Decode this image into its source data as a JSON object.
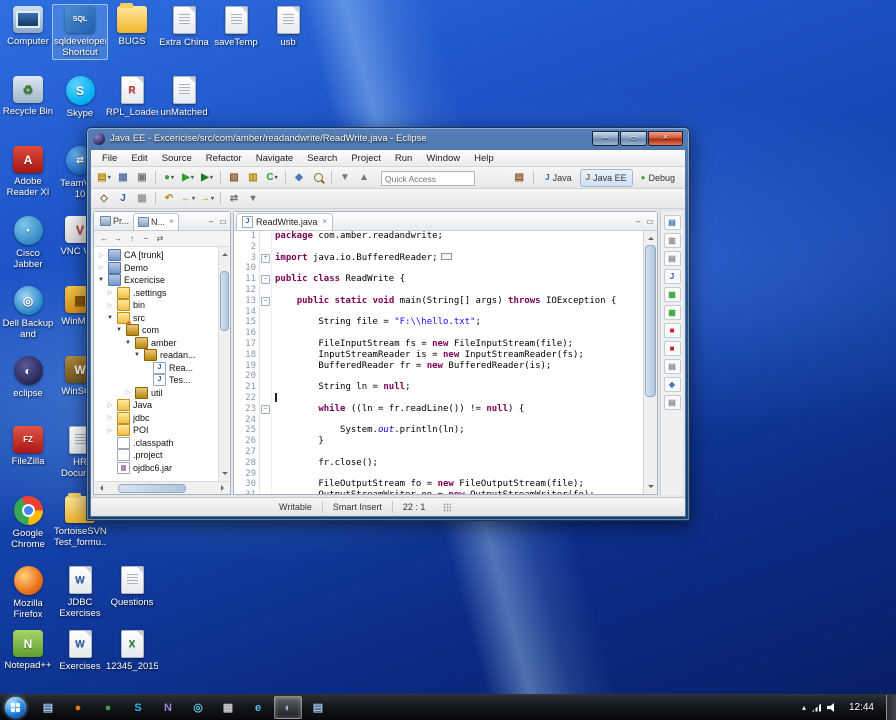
{
  "desktop": {
    "icons": [
      {
        "label": "Computer",
        "row": 0,
        "col": 0,
        "type": "pc"
      },
      {
        "label": "sqldeveloper Shortcut",
        "row": 0,
        "col": 1,
        "type": "app",
        "bg": "linear-gradient(135deg,#4e8fd0,#1f5fae)",
        "glyph": "SQL",
        "gs": 7,
        "selected": true
      },
      {
        "label": "BUGS",
        "row": 0,
        "col": 2,
        "type": "folder"
      },
      {
        "label": "Extra China",
        "row": 0,
        "col": 3,
        "type": "doc"
      },
      {
        "label": "saveTemp",
        "row": 0,
        "col": 4,
        "type": "doc"
      },
      {
        "label": "usb",
        "row": 0,
        "col": 5,
        "type": "doc"
      },
      {
        "label": "Recycle Bin",
        "row": 1,
        "col": 0,
        "type": "app",
        "bg": "linear-gradient(#dfe9f2,#9fb6c9)",
        "glyph": "♻",
        "fg": "#3f7a36"
      },
      {
        "label": "Skype",
        "row": 1,
        "col": 1,
        "type": "app",
        "bg": "radial-gradient(circle at 35% 30%,#5fd0ff,#00aff0 70%)",
        "glyph": "S",
        "round": true
      },
      {
        "label": "RPL_Loader",
        "row": 1,
        "col": 2,
        "type": "doc",
        "dl": "R",
        "dc": "#c0392b"
      },
      {
        "label": "unMatched",
        "row": 1,
        "col": 3,
        "type": "doc"
      },
      {
        "label": "Adobe Reader XI",
        "row": 2,
        "col": 0,
        "type": "app",
        "bg": "linear-gradient(#e24b3a,#a31515)",
        "glyph": "A"
      },
      {
        "label": "TeamVi... 10",
        "row": 2,
        "col": 1,
        "type": "app",
        "bg": "radial-gradient(circle at 35% 30%,#6db3f2,#1565c0 75%)",
        "glyph": "⇄",
        "gs": 9,
        "round": true
      },
      {
        "label": "Cisco Jabber",
        "row": 3,
        "col": 0,
        "type": "app",
        "bg": "radial-gradient(circle at 35% 30%,#7cc6ec,#2e86c1 75%)",
        "glyph": "●",
        "fg": "#ffffff",
        "gs": 6,
        "round": true
      },
      {
        "label": "VNC Vi...",
        "row": 3,
        "col": 1,
        "type": "app",
        "bg": "linear-gradient(#f6f6f6,#d8d8d8)",
        "glyph": "V",
        "fg": "#c0392b"
      },
      {
        "label": "Dell Backup and Recovery",
        "row": 4,
        "col": 0,
        "type": "app",
        "bg": "radial-gradient(circle at 40% 35%,#9fd4f5,#1b7ec2 75%)",
        "glyph": "◎",
        "round": true
      },
      {
        "label": "WinMe...",
        "row": 4,
        "col": 1,
        "type": "app",
        "bg": "linear-gradient(#f6c94a,#d98e1a)",
        "glyph": "▤",
        "fg": "#7a4a00"
      },
      {
        "label": "eclipse",
        "row": 5,
        "col": 0,
        "type": "app",
        "bg": "radial-gradient(circle at 40% 35%,#5a5a9e,#24244e 75%)",
        "glyph": "◐",
        "round": true
      },
      {
        "label": "WinSC...",
        "row": 5,
        "col": 1,
        "type": "app",
        "bg": "linear-gradient(#b08a3e,#6e5420)",
        "glyph": "W"
      },
      {
        "label": "FileZilla",
        "row": 6,
        "col": 0,
        "type": "app",
        "bg": "linear-gradient(#e05545,#b01515)",
        "glyph": "FZ",
        "gs": 8
      },
      {
        "label": "HR Docum...",
        "row": 6,
        "col": 1,
        "type": "doc"
      },
      {
        "label": "Google Chrome",
        "row": 7,
        "col": 0,
        "type": "chrome"
      },
      {
        "label": "TortoiseSVN Test_formu...",
        "row": 7,
        "col": 1,
        "type": "folder"
      },
      {
        "label": "Mozilla Firefox",
        "row": 8,
        "col": 0,
        "type": "app",
        "bg": "radial-gradient(circle at 35% 35%,#ffd27a,#e8731a 60%,#b4480a)",
        "round": true
      },
      {
        "label": "JDBC Exercises",
        "row": 8,
        "col": 1,
        "type": "doc",
        "dl": "W",
        "dc": "#2a5db0"
      },
      {
        "label": "Questions",
        "row": 8,
        "col": 2,
        "type": "doc"
      },
      {
        "label": "Notepad++",
        "row": 9,
        "col": 0,
        "type": "app",
        "bg": "linear-gradient(#a8d46a,#5d9e2f)",
        "glyph": "N"
      },
      {
        "label": "Exercises",
        "row": 9,
        "col": 1,
        "type": "doc",
        "dl": "W",
        "dc": "#2a5db0"
      },
      {
        "label": "12345_2015...",
        "row": 9,
        "col": 2,
        "type": "doc",
        "dl": "X",
        "dc": "#1e7e34"
      }
    ]
  },
  "window": {
    "title": "Java EE - Excericise/src/com/amber/readandwrite/ReadWrite.java - Eclipse",
    "controls": {
      "minimize": "–",
      "maximize": "▭",
      "close": "×"
    },
    "close_glyph": "×",
    "menus": [
      "File",
      "Edit",
      "Source",
      "Refactor",
      "Navigate",
      "Search",
      "Project",
      "Run",
      "Window",
      "Help"
    ],
    "quick_access_placeholder": "Quick Access",
    "open_perspective_glyph": "▤",
    "perspectives": [
      {
        "label": "Java",
        "g": "J",
        "c": "#2a5db0"
      },
      {
        "label": "Java EE",
        "g": "J",
        "c": "#8a5a2a",
        "active": true
      },
      {
        "label": "Debug",
        "g": "●",
        "c": "#3fa33f"
      }
    ],
    "toolbar1": [
      {
        "n": "new-wizard",
        "g": "▤",
        "c": "#b8860b",
        "dd": true
      },
      {
        "n": "save",
        "g": "▦",
        "c": "#5b74a8"
      },
      {
        "n": "print",
        "g": "▣",
        "c": "#777777"
      },
      {
        "sep": true
      },
      {
        "n": "debug",
        "g": "●",
        "c": "#3fa33f",
        "dd": true
      },
      {
        "n": "run",
        "g": "▶",
        "c": "#2f9e2f",
        "dd": true
      },
      {
        "n": "run-external-tools",
        "g": "▶",
        "c": "#1f7d1f",
        "dd": true
      },
      {
        "sep": true
      },
      {
        "n": "new-java-project",
        "g": "▧",
        "c": "#8a5a2a"
      },
      {
        "n": "new-package",
        "g": "▥",
        "c": "#b8860b"
      },
      {
        "n": "new-class",
        "g": "C",
        "c": "#2f9e2f",
        "dd": true
      },
      {
        "sep": true
      },
      {
        "n": "open-task",
        "g": "◆",
        "c": "#4a78b8"
      },
      {
        "n": "search",
        "mag": true
      },
      {
        "sep": true
      },
      {
        "n": "next-annotation",
        "g": "▼",
        "c": "#777777"
      },
      {
        "n": "previous-annotation",
        "g": "▲",
        "c": "#777777"
      }
    ],
    "toolbar2": [
      {
        "n": "open-type",
        "g": "◇",
        "c": "#8a5a2a"
      },
      {
        "n": "java-editor",
        "g": "J",
        "c": "#2a5db0"
      },
      {
        "n": "mark-occurrences",
        "g": "▦",
        "c": "#999999"
      },
      {
        "sep": true
      },
      {
        "n": "last-edit-location",
        "g": "↶",
        "c": "#b8860b"
      },
      {
        "n": "back",
        "g": "←",
        "c": "#b8860b",
        "dd": true
      },
      {
        "n": "forward",
        "g": "→",
        "c": "#b8860b",
        "dd": true
      },
      {
        "sep": true
      },
      {
        "n": "link-with-editor",
        "g": "⇄",
        "c": "#777777"
      },
      {
        "n": "pin-editor",
        "g": "▾",
        "c": "#777777"
      }
    ]
  },
  "explorer": {
    "tabs": [
      {
        "label": "Pr...",
        "active": false
      },
      {
        "label": "N...",
        "active": true
      }
    ],
    "header_icons": [
      {
        "n": "minimize-view",
        "g": "–"
      },
      {
        "n": "maximize-view",
        "g": "▭"
      }
    ],
    "toolbar_icons": [
      {
        "n": "back",
        "g": "←"
      },
      {
        "n": "forward",
        "g": "→"
      },
      {
        "n": "up",
        "g": "↑"
      },
      {
        "n": "collapse-all",
        "g": "−"
      },
      {
        "n": "link-with-editor",
        "g": "⇄"
      }
    ],
    "tree": [
      {
        "level": 0,
        "arrow": "c",
        "icon": "proj",
        "label": "CA [trunk]"
      },
      {
        "level": 0,
        "arrow": "c",
        "icon": "proj",
        "label": "Demo"
      },
      {
        "level": 0,
        "arrow": "o",
        "icon": "proj",
        "label": "Excericise"
      },
      {
        "level": 1,
        "arrow": "c",
        "icon": "folder",
        "label": ".settings"
      },
      {
        "level": 1,
        "arrow": "c",
        "icon": "folder",
        "label": "bin"
      },
      {
        "level": 1,
        "arrow": "o",
        "icon": "src",
        "label": "src"
      },
      {
        "level": 2,
        "arrow": "o",
        "icon": "pkg",
        "label": "com"
      },
      {
        "level": 3,
        "arrow": "o",
        "icon": "pkg",
        "label": "amber"
      },
      {
        "level": 4,
        "arrow": "o",
        "icon": "pkg",
        "label": "readan..."
      },
      {
        "level": 5,
        "arrow": "n",
        "icon": "java",
        "label": "Rea..."
      },
      {
        "level": 5,
        "arrow": "n",
        "icon": "java",
        "label": "Tes..."
      },
      {
        "level": 3,
        "arrow": "c",
        "icon": "pkg",
        "label": "util"
      },
      {
        "level": 1,
        "arrow": "c",
        "icon": "folder",
        "label": "Java"
      },
      {
        "level": 1,
        "arrow": "c",
        "icon": "folder",
        "label": "jdbc"
      },
      {
        "level": 1,
        "arrow": "c",
        "icon": "folder",
        "label": "POI"
      },
      {
        "level": 1,
        "arrow": "n",
        "icon": "file",
        "label": ".classpath"
      },
      {
        "level": 1,
        "arrow": "n",
        "icon": "file",
        "label": ".project"
      },
      {
        "level": 1,
        "arrow": "n",
        "icon": "jar",
        "label": "ojdbc6.jar"
      }
    ]
  },
  "editor": {
    "tab_label": "ReadWrite.java",
    "header_icons": [
      {
        "n": "minimize-editor",
        "g": "–"
      },
      {
        "n": "maximize-editor",
        "g": "▭"
      }
    ],
    "lines": [
      {
        "n": 1,
        "t": "package com.amber.readandwrite;"
      },
      {
        "n": 2,
        "t": ""
      },
      {
        "n": 3,
        "t": "import java.io.BufferedReader;",
        "fold": "plus",
        "collapsed": true
      },
      {
        "n": 10,
        "t": ""
      },
      {
        "n": 11,
        "t": "public class ReadWrite {",
        "fold": "minus"
      },
      {
        "n": 12,
        "t": ""
      },
      {
        "n": 13,
        "t": "    public static void main(String[] args) throws IOException {",
        "fold": "minus"
      },
      {
        "n": 14,
        "t": ""
      },
      {
        "n": 15,
        "t": "        String file = \"F:\\\\hello.txt\";"
      },
      {
        "n": 16,
        "t": ""
      },
      {
        "n": 17,
        "t": "        FileInputStream fs = new FileInputStream(file);"
      },
      {
        "n": 18,
        "t": "        InputStreamReader is = new InputStreamReader(fs);"
      },
      {
        "n": 19,
        "t": "        BufferedReader fr = new BufferedReader(is);"
      },
      {
        "n": 20,
        "t": ""
      },
      {
        "n": 21,
        "t": "        String ln = null;"
      },
      {
        "n": 22,
        "t": "",
        "cursor": true
      },
      {
        "n": 23,
        "t": "        while ((ln = fr.readLine()) != null) {",
        "fold": "minus"
      },
      {
        "n": 24,
        "t": ""
      },
      {
        "n": 25,
        "t": "            System.out.println(ln);"
      },
      {
        "n": 26,
        "t": "        }"
      },
      {
        "n": 27,
        "t": ""
      },
      {
        "n": 28,
        "t": "        fr.close();"
      },
      {
        "n": 29,
        "t": ""
      },
      {
        "n": 30,
        "t": "        FileOutputStream fo = new FileOutputStream(file);"
      },
      {
        "n": 31,
        "t": "        OutputStreamWriter oo = new OutputStreamWriter(fo);"
      }
    ]
  },
  "minimized_views": [
    {
      "g": "▤",
      "c": "#4a78b8"
    },
    {
      "g": "▥",
      "c": "#888888"
    },
    {
      "g": "▤",
      "c": "#888888"
    },
    {
      "g": "J",
      "c": "#2a5db0"
    },
    {
      "g": "▦",
      "c": "#3fa33f"
    },
    {
      "g": "▦",
      "c": "#3fa33f"
    },
    {
      "g": "■",
      "c": "#cc2222"
    },
    {
      "g": "■",
      "c": "#cc2222"
    },
    {
      "g": "▤",
      "c": "#888888"
    },
    {
      "g": "◆",
      "c": "#4a78b8"
    },
    {
      "g": "▤",
      "c": "#888888"
    }
  ],
  "status": {
    "writable": "Writable",
    "insert_mode": "Smart Insert",
    "position": "22 : 1"
  },
  "taskbar": {
    "time": "12:44",
    "apps": [
      {
        "n": "taskbar-app-document",
        "g": "▤",
        "c": "#9cc3e8"
      },
      {
        "n": "taskbar-app-firefox",
        "g": "●",
        "c": "#e8731a"
      },
      {
        "n": "taskbar-app-green",
        "g": "●",
        "c": "#43a047"
      },
      {
        "n": "taskbar-app-skype",
        "g": "S",
        "c": "#35b6e8"
      },
      {
        "n": "taskbar-app-onenote",
        "g": "N",
        "c": "#9a86d8"
      },
      {
        "n": "taskbar-app-vnc",
        "g": "◎",
        "c": "#5bc0de"
      },
      {
        "n": "taskbar-app-calculator",
        "g": "▦",
        "c": "#c8c8c8"
      },
      {
        "n": "taskbar-app-ie",
        "g": "e",
        "c": "#5bc0f0"
      },
      {
        "n": "taskbar-app-eclipse",
        "g": "◐",
        "c": "#b0b0e8",
        "active": true
      },
      {
        "n": "taskbar-app-explorer",
        "g": "▤",
        "c": "#9cc3e8"
      }
    ],
    "tray": [
      {
        "n": "show-hidden-icons",
        "g": "▴"
      },
      {
        "n": "network-icon",
        "cls": "net"
      },
      {
        "n": "volume-icon",
        "cls": "vol"
      }
    ]
  }
}
